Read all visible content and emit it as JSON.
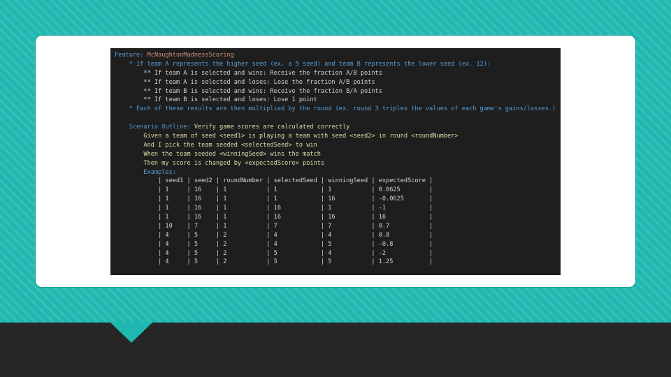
{
  "feature": {
    "keyword": "Feature:",
    "name": "McNaughtonMadnessScoring",
    "intro": "    * If team A represents the higher seed (ex. a 5 seed) and team B represents the lower seed (ex. 12):",
    "rules": [
      "        ** If team A is selected and wins: Receive the fraction A/B points",
      "        ** If team A is selected and loses: Lose the fraction A/B points",
      "        ** If team B is selected and wins: Receive the fraction B/A points",
      "        ** If team B is selected and loses: Lose 1 point"
    ],
    "round_note": "    * Each of these results are then multiplied by the round (ex. round 3 triples the values of each game's gains/losses.)"
  },
  "scenario": {
    "keyword": "    Scenario Outline:",
    "title": "Verify game scores are calculated correctly",
    "steps": [
      "        Given a team of seed <seed1> is playing a team with seed <seed2> in round <roundNumber>",
      "        And I pick the team seeded <selectedSeed> to win",
      "        When the team seeded <winningSeed> wins the match",
      "        Then my score is changed by <expectedScore> points"
    ],
    "examples_label": "        Examples:"
  },
  "examples_table": {
    "header": "            | seed1 | seed2 | roundNumber | selectedSeed | winningSeed | expectedScore |",
    "rows": [
      "            | 1     | 16    | 1           | 1            | 1           | 0.0625        |",
      "            | 1     | 16    | 1           | 1            | 16          | -0.0625       |",
      "            | 1     | 16    | 1           | 16           | 1           | -1            |",
      "            | 1     | 16    | 1           | 16           | 16          | 16            |",
      "            | 10    | 7     | 1           | 7            | 7           | 0.7           |",
      "            | 4     | 5     | 2           | 4            | 4           | 0.8           |",
      "            | 4     | 5     | 2           | 4            | 5           | -0.8          |",
      "            | 4     | 5     | 2           | 5            | 4           | -2            |",
      "            | 4     | 5     | 2           | 5            | 5           | 1.25          |"
    ]
  },
  "colors": {
    "background": "#1fb8b0",
    "editor_bg": "#1e1e1e",
    "keyword": "#569cd6",
    "string": "#ce9178",
    "step": "#dcdcaa",
    "text": "#d4d4d4"
  }
}
